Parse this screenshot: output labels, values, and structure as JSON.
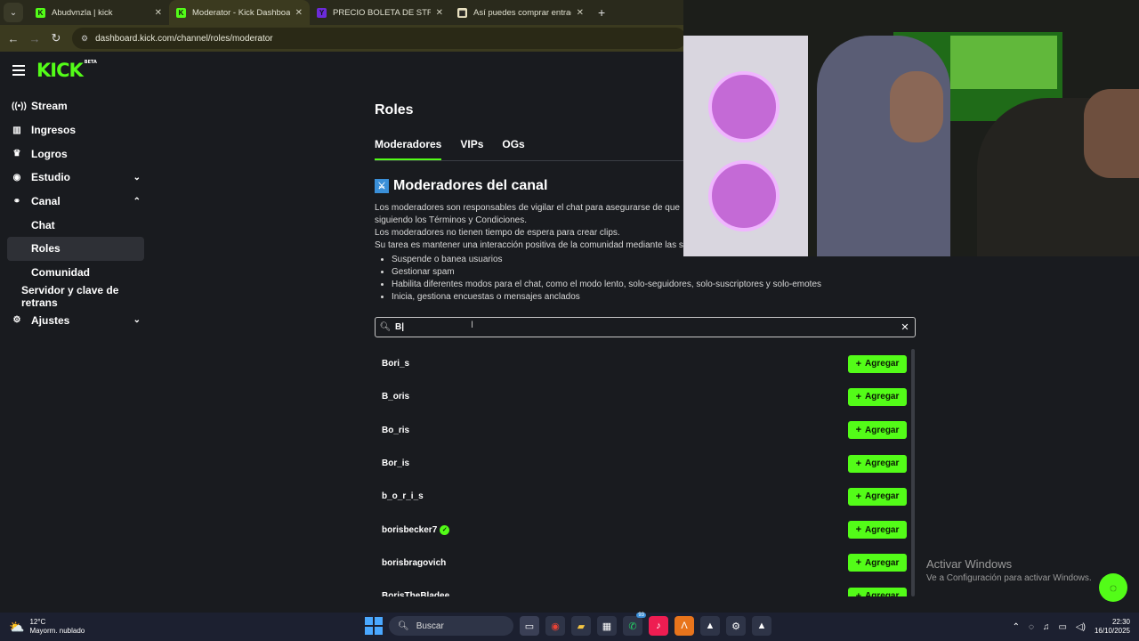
{
  "browser": {
    "tabs": [
      {
        "title": "Abudvnzla | kick",
        "fav": "K",
        "color": "#53fc18",
        "active": false
      },
      {
        "title": "Moderator - Kick Dashboard",
        "fav": "K",
        "color": "#53fc18",
        "active": true
      },
      {
        "title": "PRECIO BOLETA DE STREMFIHT",
        "fav": "Y",
        "color": "#6c2bd9",
        "active": false
      },
      {
        "title": "Así puedes comprar entradas p",
        "fav": "▦",
        "color": "#e8e0c0",
        "active": false
      }
    ],
    "url": "dashboard.kick.com/channel/roles/moderator"
  },
  "sidebar": {
    "logo": "KICK",
    "logo_badge": "BETA",
    "items": [
      {
        "label": "Stream",
        "icon": "broadcast-icon"
      },
      {
        "label": "Ingresos",
        "icon": "chart-icon"
      },
      {
        "label": "Logros",
        "icon": "trophy-icon"
      },
      {
        "label": "Estudio",
        "icon": "studio-icon"
      },
      {
        "label": "Canal",
        "icon": "channel-icon"
      },
      {
        "label": "Chat"
      },
      {
        "label": "Roles"
      },
      {
        "label": "Comunidad"
      },
      {
        "label": "Servidor y clave de retrans"
      },
      {
        "label": "Ajustes",
        "icon": "gear-icon"
      }
    ]
  },
  "main": {
    "title": "Roles",
    "tabs": [
      "Moderadores",
      "VIPs",
      "OGs"
    ],
    "section_title": "Moderadores del canal",
    "desc": [
      "Los moderadores son responsables de vigilar el chat para asegurarse de que",
      "siguiendo los Términos y Condiciones.",
      "Los moderadores no tienen tiempo de espera para crear clips.",
      "Su tarea es mantener una interacción positiva de la comunidad mediante las s"
    ],
    "bullets": [
      "Suspende o banea usuarios",
      "Gestionar spam",
      "Habilita diferentes modos para el chat, como el modo lento, solo-seguidores, solo-suscriptores y solo-emotes",
      "Inicia, gestiona encuestas o mensajes anclados"
    ],
    "search_value": "B|",
    "add_label": "Agregar",
    "results": [
      {
        "name": "Bori_s",
        "verified": false
      },
      {
        "name": "B_oris",
        "verified": false
      },
      {
        "name": "Bo_ris",
        "verified": false
      },
      {
        "name": "Bor_is",
        "verified": false
      },
      {
        "name": "b_o_r_i_s",
        "verified": false
      },
      {
        "name": "borisbecker7",
        "verified": true
      },
      {
        "name": "borisbragovich",
        "verified": false
      },
      {
        "name": "BorisTheBladee",
        "verified": false
      }
    ]
  },
  "overlay": {
    "activate_title": "Activar Windows",
    "activate_sub": "Ve a Configuración para activar Windows."
  },
  "taskbar": {
    "temp": "12°C",
    "weather": "Mayorm. nublado",
    "search": "Buscar",
    "time": "22:30",
    "date": "16/10/2025",
    "whatsapp_badge": "93"
  },
  "colors": {
    "accent": "#53fc18",
    "bg": "#191b1f"
  }
}
